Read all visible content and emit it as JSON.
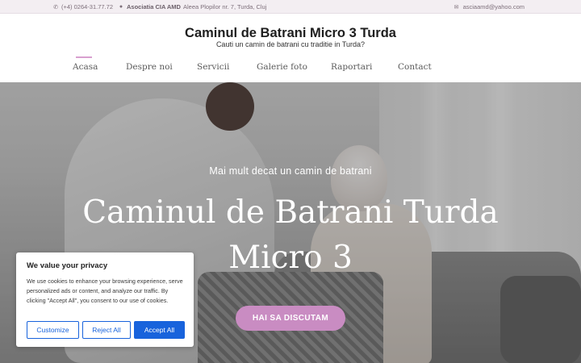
{
  "topbar": {
    "phone": "(+4) 0264-31.77.72",
    "org": "Asociatia CIA AMD",
    "address": "Aleea Plopilor nr. 7, Turda, Cluj",
    "email": "asciaamd@yahoo.com",
    "icons": [
      "phone-icon",
      "location-pin-icon",
      "envelope-icon"
    ]
  },
  "header": {
    "title": "Caminul de Batrani Micro 3 Turda",
    "tagline": "Cauti un camin de batrani cu traditie in Turda?"
  },
  "nav": {
    "items": [
      {
        "label": "Acasa",
        "active": true
      },
      {
        "label": "Despre noi"
      },
      {
        "label": "Servicii"
      },
      {
        "label": "Galerie foto"
      },
      {
        "label": "Raportari"
      },
      {
        "label": "Contact"
      }
    ],
    "active_color": "#d8a0cf"
  },
  "hero": {
    "kicker": "Mai mult decat un camin de batrani",
    "title_line1": "Caminul de Batrani Turda",
    "title_line2": "Micro 3",
    "cta_label": "HAI SA DISCUTAM",
    "cta_color": "#c98cc2"
  },
  "cookie": {
    "title": "We value your privacy",
    "text": "We use cookies to enhance your browsing experience, serve personalized ads or content, and analyze our traffic. By clicking \"Accept All\", you consent to our use of cookies.",
    "customize_label": "Customize",
    "reject_label": "Reject All",
    "accept_label": "Accept All",
    "accent_color": "#1863dc"
  }
}
